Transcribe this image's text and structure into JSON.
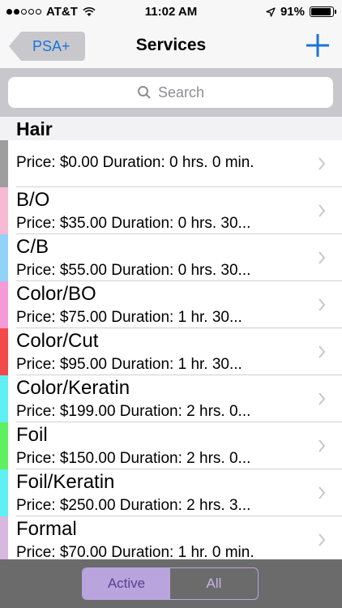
{
  "status_bar": {
    "carrier": "AT&T",
    "time": "11:02 AM",
    "battery": "91%",
    "battery_level": 0.91,
    "signal_dots_filled": 2,
    "signal_dots_total": 5
  },
  "nav": {
    "back_label": "PSA+",
    "title": "Services",
    "add_icon": "plus-icon"
  },
  "search": {
    "placeholder": "Search"
  },
  "section": {
    "title": "Hair"
  },
  "services": [
    {
      "name": "",
      "detail": "Price: $0.00  Duration: 0 hrs. 0 min.",
      "color": "#9e9e9e"
    },
    {
      "name": "B/O",
      "detail": "Price: $35.00  Duration: 0 hrs. 30...",
      "color": "#f7b9d3"
    },
    {
      "name": "C/B",
      "detail": "Price: $55.00  Duration: 0 hrs. 30...",
      "color": "#8fd3f7"
    },
    {
      "name": "Color/BO",
      "detail": "Price: $75.00  Duration: 1 hr. 30...",
      "color": "#f59ad6"
    },
    {
      "name": "Color/Cut",
      "detail": "Price: $95.00  Duration: 1 hr. 30...",
      "color": "#f24a4a"
    },
    {
      "name": "Color/Keratin",
      "detail": "Price: $199.00  Duration: 2 hrs. 0...",
      "color": "#5ef0f2"
    },
    {
      "name": "Foil",
      "detail": "Price: $150.00  Duration: 2 hrs. 0...",
      "color": "#5ef05e"
    },
    {
      "name": "Foil/Keratin",
      "detail": "Price: $250.00  Duration: 2 hrs. 3...",
      "color": "#5ef0f2"
    },
    {
      "name": "Formal",
      "detail": "Price: $70.00  Duration: 1 hr. 0 min.",
      "color": "#d9b8e0"
    }
  ],
  "segments": {
    "active": "Active",
    "all": "All",
    "selected": "Active"
  },
  "colors": {
    "accent": "#1a73d9",
    "segment_tint": "#b9a4dd",
    "bottom_bar": "#6b6b6b"
  }
}
